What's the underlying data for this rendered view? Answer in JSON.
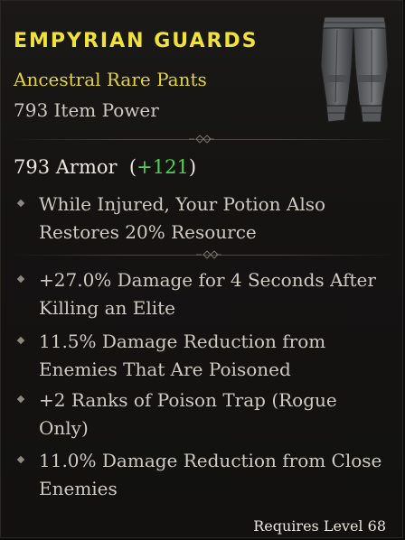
{
  "item": {
    "name": "Empyrian Guards",
    "type_line": "Ancestral Rare Pants",
    "item_power": "793 Item Power",
    "icon": "pants-icon"
  },
  "armor": {
    "value": "793 Armor",
    "paren_open": "(",
    "bonus": "+121",
    "paren_close": ")"
  },
  "implicit_affixes": [
    "While Injured, Your Potion Also Restores 20% Resource"
  ],
  "affixes": [
    "+27.0% Damage for 4 Seconds After Killing an Elite",
    "11.5% Damage Reduction from Enemies That Are Poisoned",
    "+2 Ranks of Poison Trap (Rogue Only)",
    "11.0% Damage Reduction from Close Enemies"
  ],
  "requirement": "Requires Level 68",
  "colors": {
    "title": "#f0e23a",
    "rarity": "#e3d341",
    "bonus": "#4fd24f",
    "text": "#cfcac2"
  }
}
